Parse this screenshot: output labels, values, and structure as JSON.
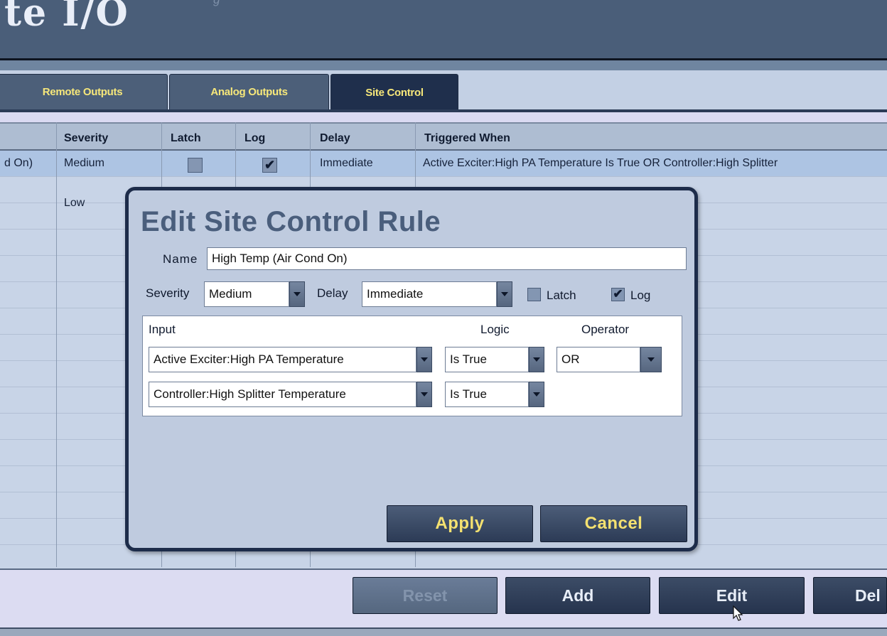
{
  "app": {
    "title": "te I/O",
    "top_fragment": "g"
  },
  "tabs": [
    {
      "label": "Remote Outputs",
      "active": false
    },
    {
      "label": "Analog Outputs",
      "active": false
    },
    {
      "label": "Site Control",
      "active": true
    }
  ],
  "table": {
    "headers": [
      "Severity",
      "Latch",
      "Log",
      "Delay",
      "Triggered When"
    ],
    "rows": [
      {
        "name": "d On)",
        "severity": "Medium",
        "latch": false,
        "log": true,
        "delay": "Immediate",
        "triggered_when": "Active Exciter:High PA Temperature Is True OR Controller:High Splitter",
        "selected": true
      },
      {
        "name": "",
        "severity": "Low",
        "latch": false,
        "log": false,
        "delay": "",
        "triggered_when": "",
        "selected": false
      }
    ]
  },
  "bottom_buttons": {
    "reset": "Reset",
    "add": "Add",
    "edit": "Edit",
    "delete": "Del"
  },
  "dialog": {
    "title": "Edit Site Control Rule",
    "name_label": "Name",
    "name_value": "High Temp (Air Cond On)",
    "severity_label": "Severity",
    "severity_value": "Medium",
    "delay_label": "Delay",
    "delay_value": "Immediate",
    "latch_label": "Latch",
    "latch_checked": false,
    "log_label": "Log",
    "log_checked": true,
    "columns": {
      "input": "Input",
      "logic": "Logic",
      "operator": "Operator"
    },
    "rules": [
      {
        "input": "Active Exciter:High PA Temperature",
        "logic": "Is True",
        "operator": "OR"
      },
      {
        "input": "Controller:High Splitter Temperature",
        "logic": "Is True",
        "operator": ""
      }
    ],
    "apply_label": "Apply",
    "cancel_label": "Cancel"
  },
  "colors": {
    "header_bg": "#4a5e79",
    "tab_active": "#1f2f4c",
    "tab_text": "#f6e77a",
    "dialog_border": "#1d2c4a",
    "dialog_button_text": "#f5e170"
  }
}
